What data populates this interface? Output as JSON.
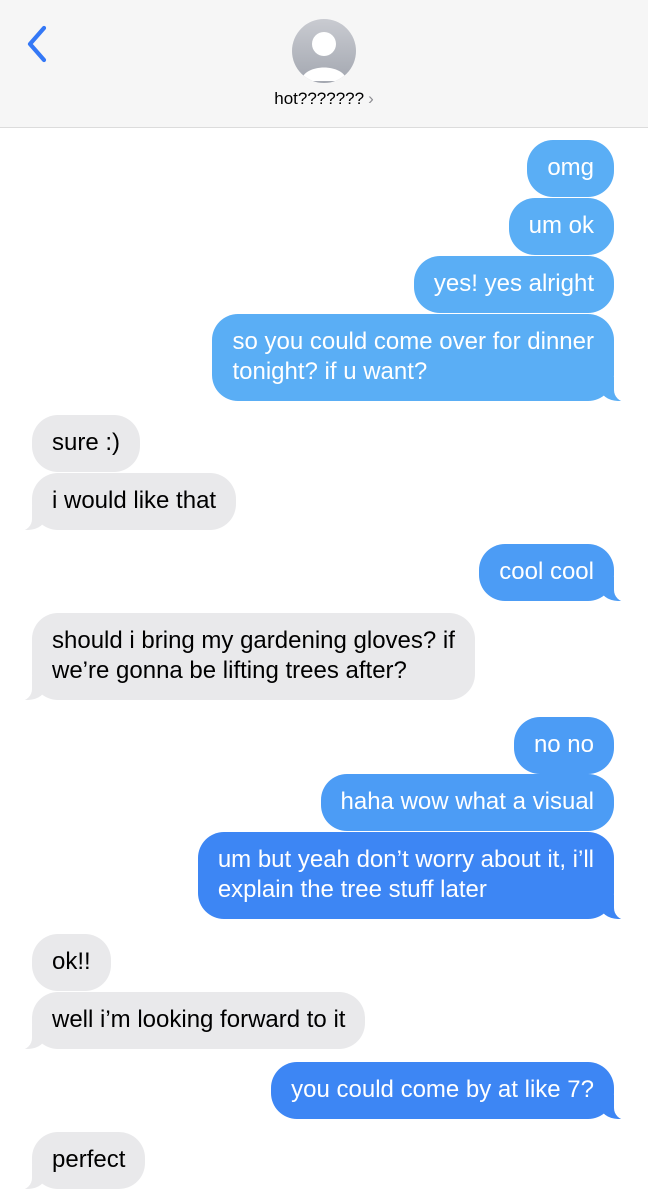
{
  "header": {
    "back_icon": "chevron-left-icon",
    "avatar_icon": "person-avatar-icon",
    "contact_name": "hot???????",
    "contact_chevron": "›"
  },
  "colors": {
    "out_light": "#5aaef5",
    "out_mid": "#4c9cf5",
    "out_dark": "#3d86f4",
    "incoming": "#e9e9eb",
    "back_accent": "#3478f6"
  },
  "messages": [
    {
      "from": "me",
      "text": "omg"
    },
    {
      "from": "me",
      "text": "um ok"
    },
    {
      "from": "me",
      "text": "yes! yes alright"
    },
    {
      "from": "me",
      "text": "so you could come over for dinner\ntonight? if u want?"
    },
    {
      "from": "them",
      "text": "sure :)"
    },
    {
      "from": "them",
      "text": "i would like that"
    },
    {
      "from": "me",
      "text": "cool cool"
    },
    {
      "from": "them",
      "text": "should i bring my gardening gloves? if\nwe’re gonna be lifting trees after?"
    },
    {
      "from": "me",
      "text": "no no"
    },
    {
      "from": "me",
      "text": "haha wow what a visual"
    },
    {
      "from": "me",
      "text": "um but yeah don’t worry about it, i’ll\nexplain the tree stuff later"
    },
    {
      "from": "them",
      "text": "ok!!"
    },
    {
      "from": "them",
      "text": "well i’m looking forward to it"
    },
    {
      "from": "me",
      "text": "you could come by at like 7?"
    },
    {
      "from": "them",
      "text": "perfect"
    }
  ]
}
